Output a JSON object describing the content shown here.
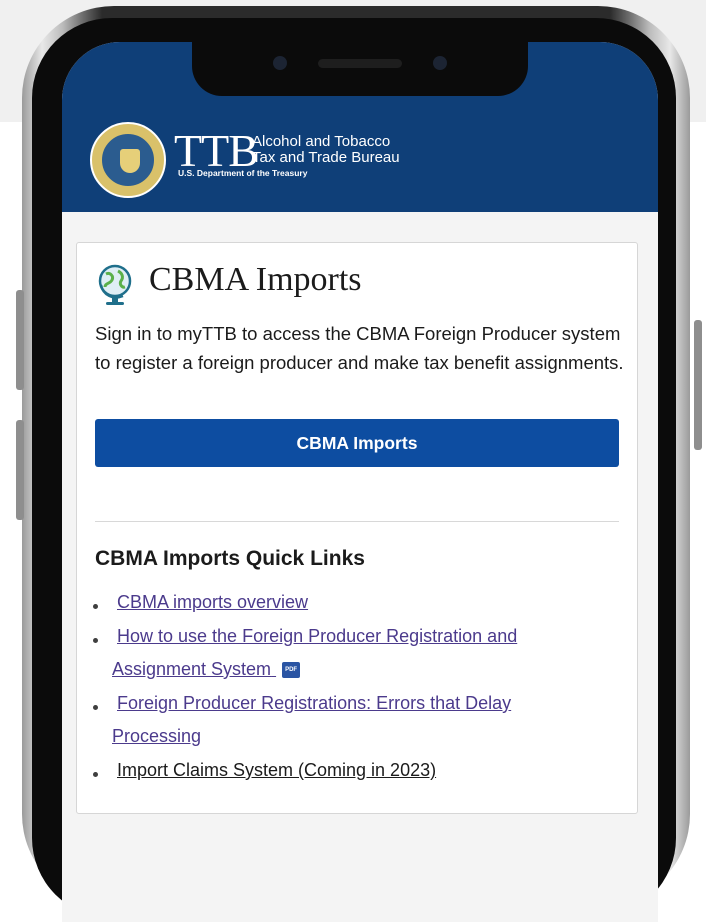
{
  "header": {
    "logo_text": "TTB",
    "agency_line1": "Alcohol and Tobacco",
    "agency_line2": "Tax and Trade Bureau",
    "department": "U.S. Department of the Treasury"
  },
  "card": {
    "title": "CBMA Imports",
    "description": "Sign in to myTTB to access the CBMA Foreign Producer system to register a foreign producer and make tax benefit assignments.",
    "button_label": "CBMA Imports",
    "quick_links_title": "CBMA Imports Quick Links",
    "links": [
      {
        "line1": "CBMA imports overview",
        "line2": ""
      },
      {
        "line1": "How to use the Foreign Producer Registration and",
        "line2": "Assignment System"
      },
      {
        "line1": "Foreign Producer Registrations: Errors that Delay",
        "line2": "Processing"
      },
      {
        "line1": "Import Claims System (Coming in 2023)",
        "line2": ""
      }
    ],
    "pdf_badge": "PDF"
  },
  "colors": {
    "header_bg": "#0f3f78",
    "button_bg": "#0d4da1",
    "link": "#4b3a8c"
  },
  "icons": [
    "globe-icon",
    "pdf-icon",
    "treasury-seal"
  ]
}
